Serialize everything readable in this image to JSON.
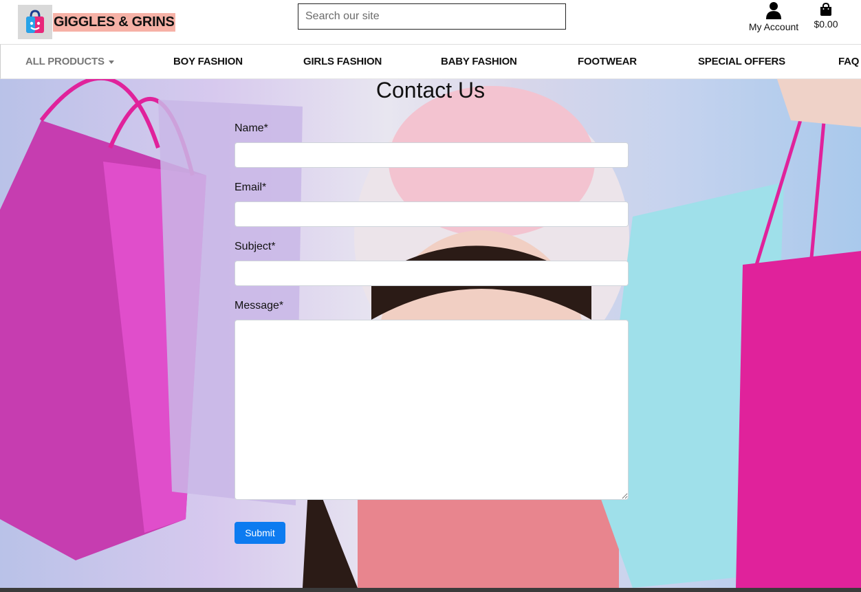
{
  "brand": {
    "name": "GIGGLES & GRINS"
  },
  "search": {
    "placeholder": "Search our site"
  },
  "account": {
    "label": "My Account"
  },
  "cart": {
    "total": "$0.00"
  },
  "nav": {
    "items": [
      {
        "label": "ALL PRODUCTS"
      },
      {
        "label": "BOY FASHION"
      },
      {
        "label": "GIRLS FASHION"
      },
      {
        "label": "BABY FASHION"
      },
      {
        "label": "FOOTWEAR"
      },
      {
        "label": "SPECIAL OFFERS"
      },
      {
        "label": "FAQ"
      }
    ]
  },
  "form": {
    "title": "Contact Us",
    "name_label": "Name*",
    "email_label": "Email*",
    "subject_label": "Subject*",
    "message_label": "Message*",
    "submit_label": "Submit"
  },
  "colors": {
    "brand_highlight": "#f6b1a6",
    "primary": "#0d7bf0",
    "bag_pink": "#e0229b",
    "bag_light_blue": "#9fe0ea"
  },
  "icons": {
    "account": "user-icon",
    "cart": "shopping-bag-icon",
    "logo": "shopping-bag-logo-icon"
  }
}
